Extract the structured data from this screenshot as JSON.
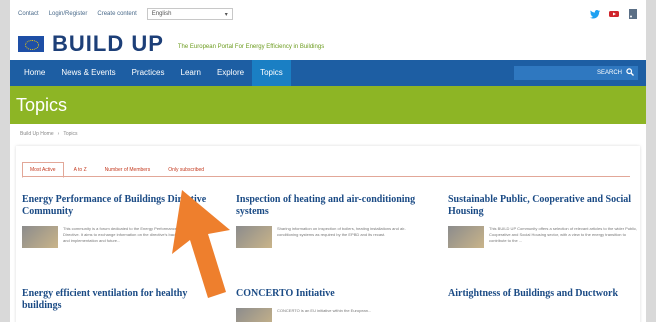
{
  "topbar": {
    "links": [
      "Contact",
      "Login/Register",
      "Create content"
    ],
    "language": "English"
  },
  "brand": {
    "logo_text": "BUILD UP",
    "tagline": "The European Portal For Energy Efficiency in Buildings"
  },
  "nav": {
    "items": [
      "Home",
      "News & Events",
      "Practices",
      "Learn",
      "Explore",
      "Topics"
    ],
    "search_label": "SEARCH"
  },
  "banner": {
    "title": "Topics"
  },
  "breadcrumb": [
    "Build Up Home",
    "Topics"
  ],
  "tabs": [
    "Most Active",
    "A to Z",
    "Number of Members",
    "Only subscribed"
  ],
  "communities": [
    {
      "title": "Energy Performance of Buildings Directive Community",
      "desc": "This community is a forum dedicated to the Energy Performance of Buildings Directive. It aims to exchange information on the directive's background, contents and implementation and future..."
    },
    {
      "title": "Inspection of heating and air-conditioning systems",
      "desc": "Sharing information on inspection of boilers, heating installations and air-conditioning systems as required by the EPBD and its recast."
    },
    {
      "title": "Sustainable Public, Cooperative and Social Housing",
      "desc": "This BUILD UP Community offers a selection of relevant articles to the wider Public, Cooperative and Social Housing sector, with a view to the energy transition to contribute to the ..."
    },
    {
      "title": "Energy efficient ventilation for healthy buildings",
      "desc": ""
    },
    {
      "title": "CONCERTO Initiative",
      "desc": "CONCERTO is an EU initiative within the European..."
    },
    {
      "title": "Airtightness of Buildings and Ductwork",
      "desc": ""
    }
  ],
  "colors": {
    "nav_bg": "#1d5ea3",
    "banner_bg": "#8db525",
    "title_blue": "#1b4b85",
    "tab_red": "#c43a1f",
    "arrow_orange": "#ee7f2d"
  }
}
